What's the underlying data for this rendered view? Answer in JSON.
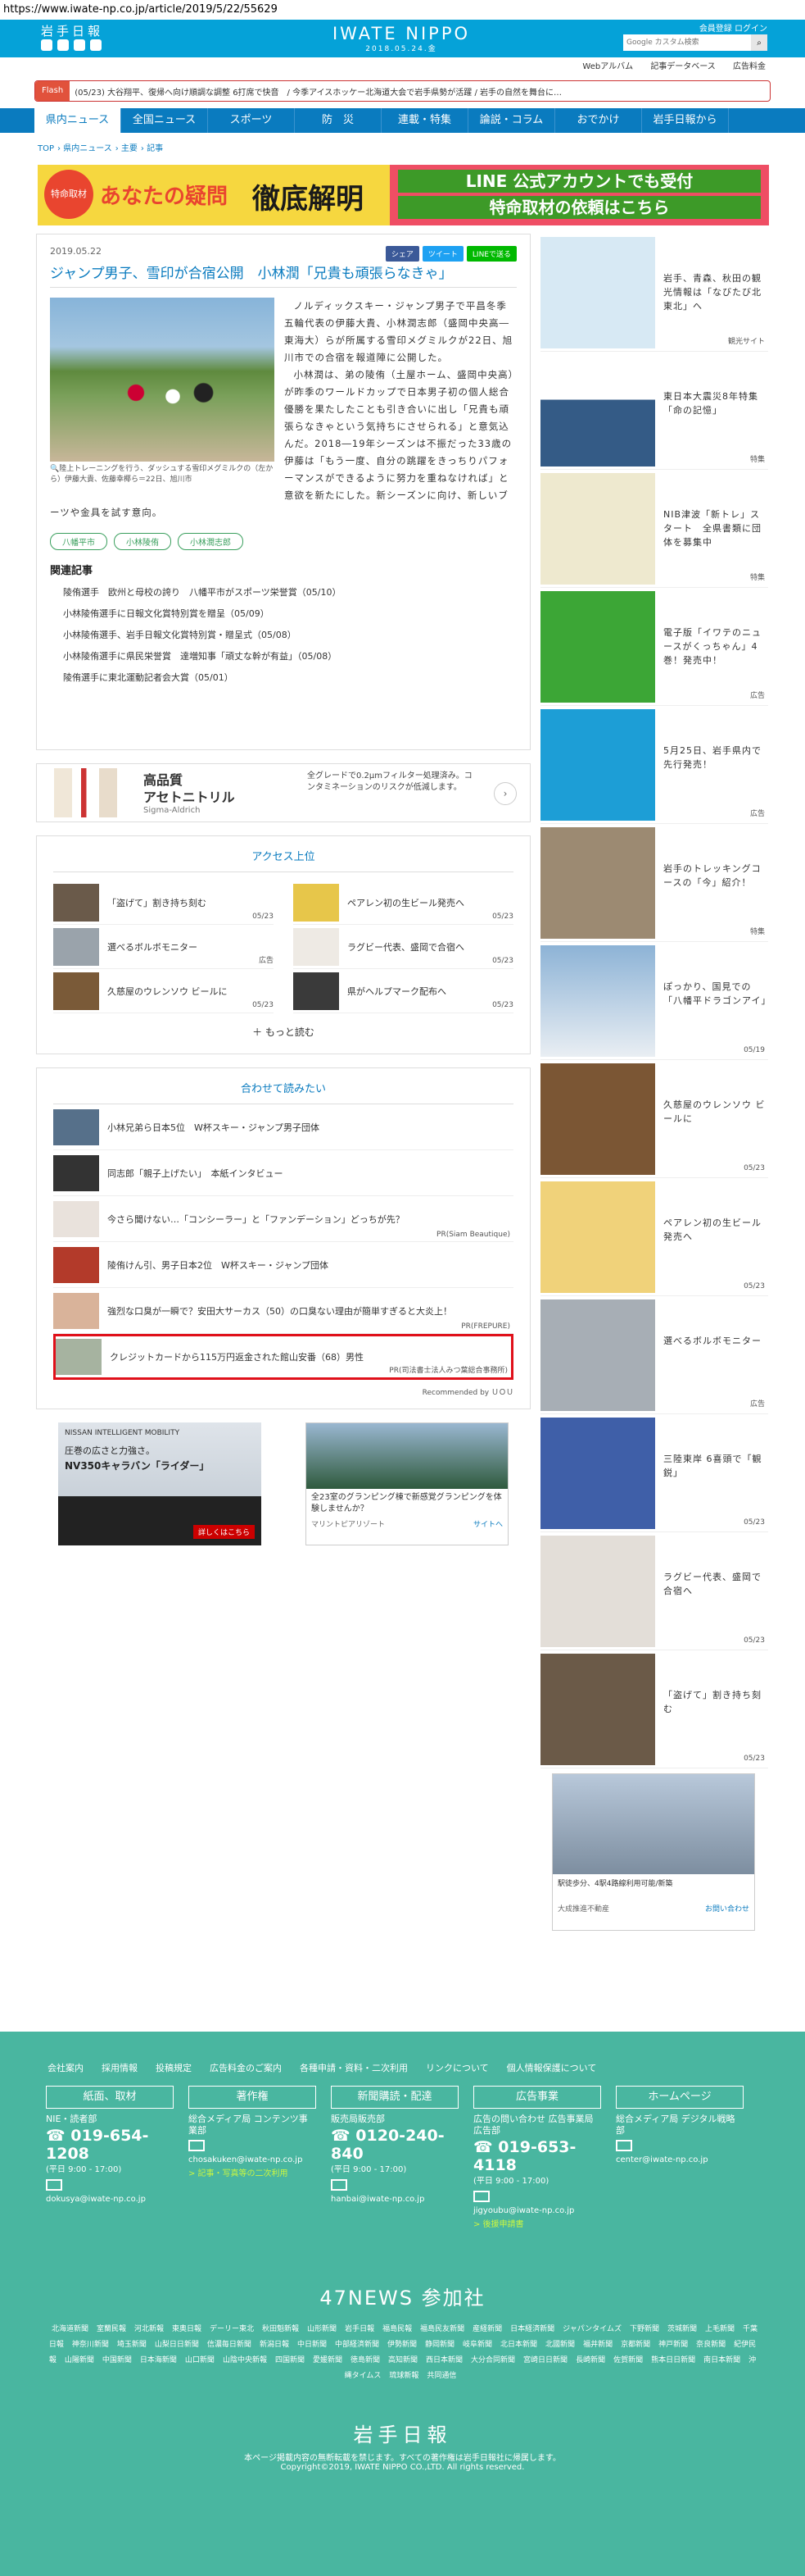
{
  "url": "https://www.iwate-np.co.jp/article/2019/5/22/55629",
  "header": {
    "logo_jp": "岩手日報",
    "title": "IWATE NIPPO",
    "date": "2018.05.24.金",
    "account": "会員登録 ログイン",
    "search_placeholder": "Google カスタム検索",
    "subnav": [
      "Webアルバム",
      "記事データベース",
      "広告料金"
    ]
  },
  "flash": {
    "label": "Flash",
    "text": "(05/23) 大谷翔平、復帰へ向け順調な調整 6打席で快音　/ 今季アイスホッケー北海道大会で岩手県勢が活躍 / 岩手の自然を舞台に…"
  },
  "gnav": [
    "県内ニュース",
    "全国ニュース",
    "スポーツ",
    "防　災",
    "連載・特集",
    "論説・コラム",
    "おでかけ",
    "岩手日報から"
  ],
  "breadcrumb": [
    "TOP",
    "県内ニュース",
    "主要",
    "記事"
  ],
  "banner": {
    "badge": "特命取材",
    "left": "あなたの疑問",
    "center": "徹底解明",
    "right1": "LINE 公式アカウントでも受付",
    "right2": "特命取材の依頼はこちら"
  },
  "article": {
    "date": "2019.05.22",
    "share": [
      "シェア",
      "ツイート",
      "LINEで送る"
    ],
    "title": "ジャンプ男子、雪印が合宿公開　小林潤「兄貴も頑張らなきゃ」",
    "caption": "陸上トレーニングを行う、ダッシュする雪印メグミルクの（左から）伊藤大貴、佐藤幸椰ら＝22日、旭川市",
    "p1": "ノルディックスキー・ジャンプ男子で平昌冬季五輪代表の伊藤大貴、小林潤志郎（盛岡中央高―東海大）らが所属する雪印メグミルクが22日、旭川市での合宿を報道陣に公開した。",
    "p2": "小林潤は、弟の陵侑（土屋ホーム、盛岡中央高）が昨季のワールドカップで日本男子初の個人総合優勝を果たしたことも引き合いに出し「兄貴も頑張らなきゃという気持ちにさせられる」と意気込んだ。2018―19年シーズンは不振だった33歳の伊藤は「もう一度、自分の跳躍をきっちりパフォーマンスができるように努力を重ねなければ」と意欲を新たにした。新シーズンに向け、新しいブーツや金具を試す意向。"
  },
  "tags": [
    "八幡平市",
    "小林陵侑",
    "小林潤志郎"
  ],
  "related": {
    "title": "関連記事",
    "items": [
      "陵侑選手　欧州と母校の誇り　八幡平市がスポーツ栄誉賞（05/10）",
      "小林陵侑選手に日報文化賞特別賞を贈呈（05/09）",
      "小林陵侑選手、岩手日報文化賞特別賞・贈呈式（05/08）",
      "小林陵侑選手に県民栄誉賞　達増知事「頑丈な幹が有益」（05/08）",
      "陵侑選手に東北運動記者会大賞（05/01）"
    ]
  },
  "ad1": {
    "title1": "高品質",
    "title2": "アセトニトリル",
    "brand": "Sigma-Aldrich",
    "desc": "全グレードで0.2μmフィルター処理済み。コンタミネーションのリスクが低減します。"
  },
  "ranking": {
    "title": "アクセス上位",
    "items": [
      {
        "t": "「盗げて」割き持ち刻む",
        "d": "05/23"
      },
      {
        "t": "ペアレン初の生ビール発売へ",
        "d": "05/23"
      },
      {
        "t": "選べるボルボモニター",
        "d": "広告"
      },
      {
        "t": "ラグビー代表、盛岡で合宿へ",
        "d": "05/23"
      },
      {
        "t": "久慈屋のウレンソウ ビールに",
        "d": "05/23"
      },
      {
        "t": "県がヘルプマーク配布へ",
        "d": "05/23"
      }
    ],
    "more": "もっと読む"
  },
  "recommend": {
    "title": "合わせて読みたい",
    "items": [
      {
        "t": "小林兄弟ら日本5位　W杯スキー・ジャンプ男子団体",
        "p": ""
      },
      {
        "t": "同志郎「親子上げたい」　本紙インタビュー",
        "p": ""
      },
      {
        "t": "今さら聞けない…「コンシーラー」と「ファンデーション」どっちが先？",
        "p": "PR(Siam Beautique)"
      },
      {
        "t": "陵侑けん引、男子日本2位　W杯スキー・ジャンプ団体",
        "p": ""
      },
      {
        "t": "強烈な口臭が一瞬で？安田大サーカス（50）の口臭ない理由が簡単すぎると大炎上！",
        "p": "PR(FREPURE)"
      },
      {
        "t": "クレジットカードから115万円返金された館山安番（68）男性",
        "p": "PR(司法書士法人みつ葉総合事務所)"
      }
    ],
    "footer": "Recommended by ＵＯＵ"
  },
  "ads2": {
    "nissan_line1": "NISSAN INTELLIGENT MOBILITY",
    "nissan_line2": "圧巻の広さと力強さ。",
    "nissan_line3": "NV350キャラバン「ライダー」",
    "nissan_btn": "詳しくはこちら",
    "glamp_text": "全23室のグランピング棟で新感覚グランピングを体験しませんか？",
    "glamp_src": "マリントピアリゾート",
    "glamp_site": "サイトへ"
  },
  "side": [
    {
      "t": "岩手、青森、秋田の観光情報は「なびたび北東北」へ",
      "d": "観光サイト"
    },
    {
      "t": "東日本大震災8年特集「命の記憶」",
      "d": "特集"
    },
    {
      "t": "NIB津波「新トレ」スタート　全県書類に団体を募集中",
      "d": "特集"
    },
    {
      "t": "電子版「イワテのニュースがくっちゃん」4巻！発売中！",
      "d": "広告"
    },
    {
      "t": "5月25日、岩手県内で先行発売！",
      "d": "広告"
    },
    {
      "t": "岩手のトレッキングコースの「今」紹介！",
      "d": "特集"
    },
    {
      "t": "ぽっかり、国見での「八幡平ドラゴンアイ」",
      "d": "05/19"
    },
    {
      "t": "久慈屋のウレンソウ ビールに",
      "d": "05/23"
    },
    {
      "t": "ペアレン初の生ビール発売へ",
      "d": "05/23"
    },
    {
      "t": "選べるボルボモニター",
      "d": "広告"
    },
    {
      "t": "三陸東岸 6喜頭で「観鋭」",
      "d": "05/23"
    },
    {
      "t": "ラグビー代表、盛岡で合宿へ",
      "d": "05/23"
    },
    {
      "t": "「盗げて」割き持ち刻む",
      "d": "05/23"
    }
  ],
  "ad3": {
    "text": "駅徒歩分、4駅4路線利用可能/新築",
    "brand": "大成推進不動産",
    "link": "お問い合わせ"
  },
  "footer": {
    "links": [
      "会社案内",
      "採用情報",
      "投稿規定",
      "広告料金のご案内",
      "各種申請・資料・二次利用",
      "リンクについて",
      "個人情報保護について"
    ],
    "cols": [
      {
        "h": "紙面、取材",
        "l": "NIE・読者部",
        "ph": "019-654-1208",
        "sm": "(平日 9:00 - 17:00)",
        "mail": "dokusya@iwate-np.co.jp",
        "g": ""
      },
      {
        "h": "著作権",
        "l": "総合メディア局 コンテンツ事業部",
        "ph": "",
        "sm": "",
        "mail": "chosakuken@iwate-np.co.jp",
        "g": "> 記事・写真等の二次利用"
      },
      {
        "h": "新聞購読・配達",
        "l": "販売局販売部",
        "ph": "0120-240-840",
        "sm": "(平日 9:00 - 17:00)",
        "mail": "hanbai@iwate-np.co.jp",
        "g": ""
      },
      {
        "h": "広告事業",
        "l": "広告の問い合わせ 広告事業局広告部",
        "ph": "019-653-4118",
        "sm": "(平日 9:00 - 17:00)",
        "mail": "jigyoubu@iwate-np.co.jp",
        "g": "> 後援申請書"
      },
      {
        "h": "ホームページ",
        "l": "総合メディア局 デジタル戦略部",
        "ph": "",
        "sm": "",
        "mail": "center@iwate-np.co.jp",
        "g": ""
      }
    ],
    "n47": "47NEWS 参加社",
    "papers": [
      "北海道新聞",
      "室蘭民報",
      "河北新報",
      "東奥日報",
      "デーリー東北",
      "秋田魁新報",
      "山形新聞",
      "岩手日報",
      "福島民報",
      "福島民友新聞",
      "産経新聞",
      "日本経済新聞",
      "ジャパンタイムズ",
      "下野新聞",
      "茨城新聞",
      "上毛新聞",
      "千葉日報",
      "神奈川新聞",
      "埼玉新聞",
      "山梨日日新聞",
      "信濃毎日新聞",
      "新潟日報",
      "中日新聞",
      "中部経済新聞",
      "伊勢新聞",
      "静岡新聞",
      "岐阜新聞",
      "北日本新聞",
      "北國新聞",
      "福井新聞",
      "京都新聞",
      "神戸新聞",
      "奈良新聞",
      "紀伊民報",
      "山陽新聞",
      "中国新聞",
      "日本海新聞",
      "山口新聞",
      "山陰中央新報",
      "四国新聞",
      "愛媛新聞",
      "徳島新聞",
      "高知新聞",
      "西日本新聞",
      "大分合同新聞",
      "宮崎日日新聞",
      "長崎新聞",
      "佐賀新聞",
      "熊本日日新聞",
      "南日本新聞",
      "沖縄タイムス",
      "琉球新報",
      "共同通信"
    ],
    "logo": "岩手日報",
    "copy1": "本ページ掲載内容の無断転載を禁じます。すべての著作権は岩手日報社に帰属します。",
    "copy2": "Copyright©2019, IWATE NIPPO CO.,LTD. All rights reserved."
  }
}
